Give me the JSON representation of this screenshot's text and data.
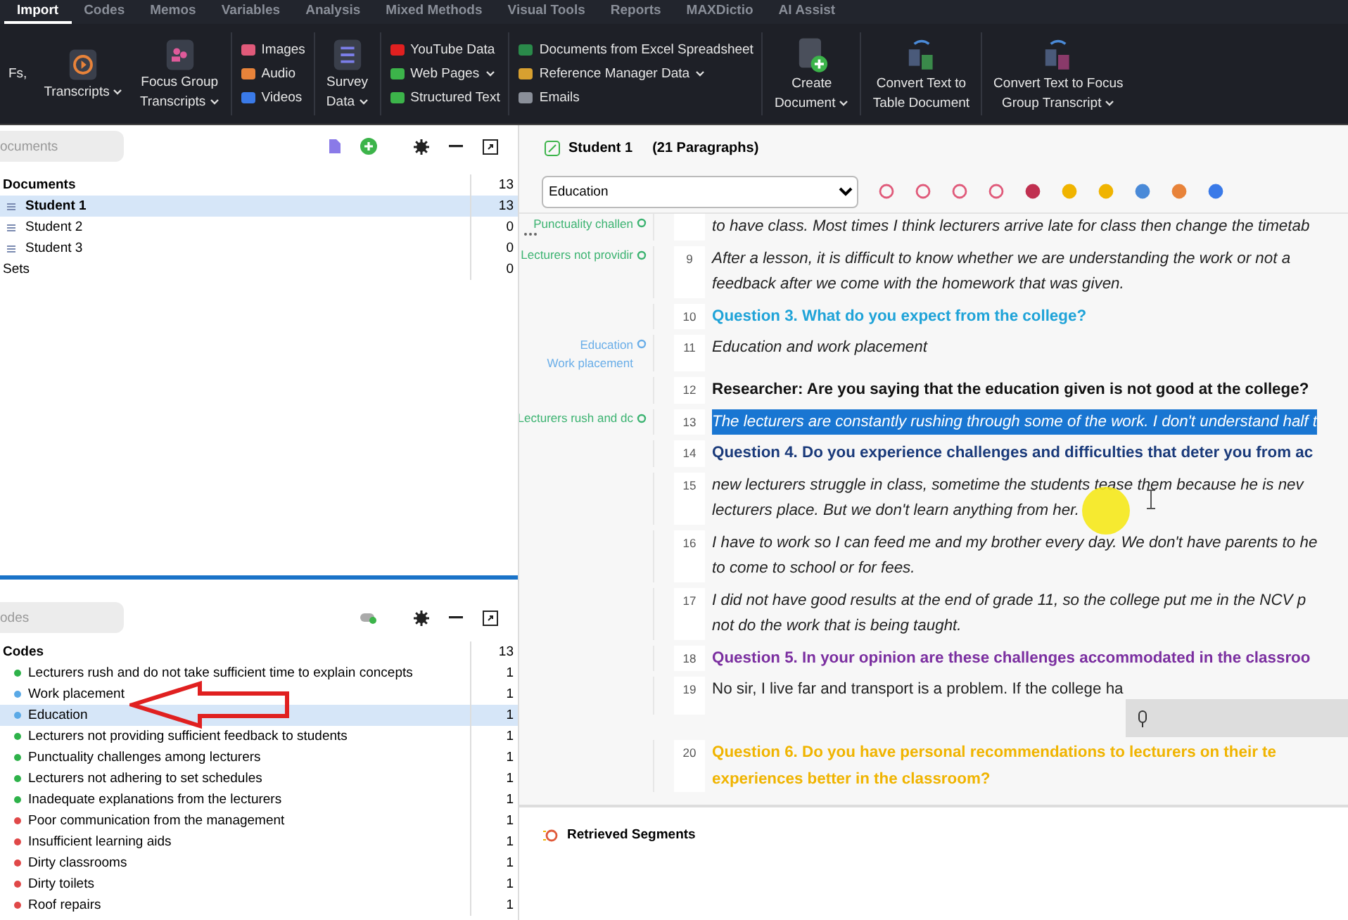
{
  "tabs": [
    {
      "label": "Import",
      "selected": true
    },
    {
      "label": "Codes",
      "selected": false
    },
    {
      "label": "Memos",
      "selected": false
    },
    {
      "label": "Variables",
      "selected": false
    },
    {
      "label": "Analysis",
      "selected": false
    },
    {
      "label": "Mixed Methods",
      "selected": false
    },
    {
      "label": "Visual Tools",
      "selected": false
    },
    {
      "label": "Reports",
      "selected": false
    },
    {
      "label": "MAXDictio",
      "selected": false
    },
    {
      "label": "AI Assist",
      "selected": false
    }
  ],
  "ribbon": [
    {
      "kind": "large",
      "lines": [
        "Fs,"
      ],
      "dropdown": false
    },
    {
      "kind": "large",
      "lines": [
        "Transcripts"
      ],
      "dropdown": true
    },
    {
      "kind": "large",
      "lines": [
        "Focus Group",
        "Transcripts"
      ],
      "dropdown": true
    },
    {
      "kind": "stack",
      "items": [
        {
          "label": "Images",
          "dropdown": false
        },
        {
          "label": "Audio",
          "dropdown": false
        },
        {
          "label": "Videos",
          "dropdown": false
        }
      ]
    },
    {
      "kind": "large",
      "lines": [
        "Survey",
        "Data"
      ],
      "dropdown": true
    },
    {
      "kind": "stack",
      "items": [
        {
          "label": "YouTube Data",
          "dropdown": false
        },
        {
          "label": "Web Pages",
          "dropdown": true
        },
        {
          "label": "Structured Text",
          "dropdown": false
        }
      ]
    },
    {
      "kind": "stack",
      "items": [
        {
          "label": "Documents from Excel Spreadsheet",
          "dropdown": false
        },
        {
          "label": "Reference Manager Data",
          "dropdown": true
        },
        {
          "label": "Emails",
          "dropdown": false
        }
      ]
    },
    {
      "kind": "large",
      "lines": [
        "Create",
        "Document"
      ],
      "dropdown": true
    },
    {
      "kind": "large",
      "lines": [
        "Convert Text to",
        "Table Document"
      ],
      "dropdown": false
    },
    {
      "kind": "large",
      "lines": [
        "Convert Text to Focus",
        "Group Transcript"
      ],
      "dropdown": true
    }
  ],
  "documents": {
    "search_placeholder": "ocuments",
    "tree": [
      {
        "label": "Documents",
        "count": "13",
        "selected": false,
        "children": [
          {
            "label": "Student 1",
            "count": "13",
            "selected": true
          },
          {
            "label": "Student 2",
            "count": "0",
            "selected": false
          },
          {
            "label": "Student 3",
            "count": "0",
            "selected": false
          }
        ]
      },
      {
        "label": "Sets",
        "count": "0",
        "selected": false
      }
    ]
  },
  "codes": {
    "search_placeholder": "odes",
    "root": {
      "label": "Codes",
      "count": "13"
    },
    "items": [
      {
        "label": "Lecturers rush and do not take sufficient time to explain concepts",
        "count": "1",
        "color": "#2eb24a",
        "selected": false
      },
      {
        "label": "Work placement",
        "count": "1",
        "color": "#5aa9e6",
        "selected": false
      },
      {
        "label": "Education",
        "count": "1",
        "color": "#5aa9e6",
        "selected": true
      },
      {
        "label": "Lecturers not providing sufficient feedback to students",
        "count": "1",
        "color": "#2eb24a",
        "selected": false
      },
      {
        "label": "Punctuality challenges among lecturers",
        "count": "1",
        "color": "#2eb24a",
        "selected": false
      },
      {
        "label": "Lecturers not adhering to set schedules",
        "count": "1",
        "color": "#2eb24a",
        "selected": false
      },
      {
        "label": "Inadequate explanations from the lecturers",
        "count": "1",
        "color": "#2eb24a",
        "selected": false
      },
      {
        "label": "Poor communication from the management",
        "count": "1",
        "color": "#e04848",
        "selected": false
      },
      {
        "label": "Insufficient learning aids",
        "count": "1",
        "color": "#e04848",
        "selected": false
      },
      {
        "label": "Dirty classrooms",
        "count": "1",
        "color": "#e04848",
        "selected": false
      },
      {
        "label": "Dirty toilets",
        "count": "1",
        "color": "#e04848",
        "selected": false
      },
      {
        "label": "Roof repairs",
        "count": "1",
        "color": "#e04848",
        "selected": false
      }
    ]
  },
  "document": {
    "title": "Student 1",
    "subtitle": "(21 Paragraphs)",
    "code_select": "Education",
    "rows": [
      {
        "kind": "italic",
        "lines": [
          "to have class. Most times I think lecturers arrive late for class then change the timetab"
        ],
        "codes": [
          {
            "label": "Punctuality challen",
            "color": "#3cb371"
          }
        ]
      },
      {
        "number": "9",
        "kind": "italic",
        "lines": [
          "After a lesson, it is difficult to know whether we are understanding the work or not a",
          "feedback after we come with the homework that was given."
        ],
        "codes": [
          {
            "label": "Lecturers not providir",
            "color": "#3cb371"
          }
        ]
      },
      {
        "number": "10",
        "kind": "question",
        "color": "#1fa3d8",
        "lines": [
          "Question 3. What do you expect from the college?"
        ],
        "codes": []
      },
      {
        "number": "11",
        "kind": "italic",
        "lines": [
          "Education and work placement"
        ],
        "codes": [
          {
            "label": "Education",
            "color": "#6aaee8"
          },
          {
            "label": "Work placement",
            "color": "#6aaee8"
          }
        ]
      },
      {
        "number": "12",
        "kind": "researcher",
        "lines": [
          "Researcher: Are you saying that the education given is not good at the college?"
        ],
        "codes": []
      },
      {
        "number": "13",
        "kind": "highlighted",
        "lines": [
          "The lecturers are constantly rushing through some of the work. I don't understand half t"
        ],
        "codes": [
          {
            "label": "Lecturers rush and dc",
            "color": "#3cb371"
          }
        ]
      },
      {
        "number": "14",
        "kind": "question",
        "color": "#1a3a7a",
        "lines": [
          "Question 4. Do you experience challenges and difficulties that deter you from ac"
        ],
        "codes": []
      },
      {
        "number": "15",
        "kind": "italic",
        "lines": [
          "new lecturers struggle in class, sometime the students tease them because he is nev",
          "lecturers place. But we don't learn anything from her."
        ],
        "codes": []
      },
      {
        "number": "16",
        "kind": "italic",
        "lines": [
          "I have to work so I can feed me and my brother every day. We don't have parents to he",
          "to come to school or for fees."
        ],
        "codes": []
      },
      {
        "number": "17",
        "kind": "italic",
        "lines": [
          "I did not have good results at the end of grade 11, so the college put me in the NCV p",
          "not do the work that is being taught."
        ],
        "codes": []
      },
      {
        "number": "18",
        "kind": "question",
        "color": "#7b2fa0",
        "lines": [
          "Question 5. In your opinion are these challenges accommodated in the classroo"
        ],
        "codes": []
      },
      {
        "number": "19",
        "kind": "plain",
        "lines": [
          "No sir, I live far and transport is a problem. If the college ha"
        ],
        "codes": []
      },
      {
        "number": "20",
        "kind": "question",
        "color": "#f0b400",
        "lines": [
          "Question 6. Do you have personal recommendations to lecturers on their te",
          "experiences better in the classroom?"
        ],
        "codes": []
      }
    ]
  },
  "retrieved": {
    "title": "Retrieved Segments"
  }
}
